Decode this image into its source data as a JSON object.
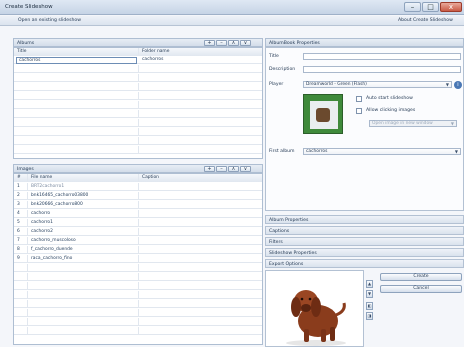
{
  "window": {
    "title": "Create Slideshow",
    "min": "–",
    "max": "□",
    "close": "x"
  },
  "toolbar": {
    "open_link": "Open an existing slideshow",
    "about_link": "About Create Slideshow"
  },
  "albums": {
    "heading": "Albums",
    "columns": [
      "Title",
      "Folder name"
    ],
    "rows": [
      {
        "title": "cachorros",
        "folder": "cachorros"
      }
    ],
    "buttons": {
      "add": "+",
      "remove": "–",
      "up": "∧",
      "down": "∨"
    }
  },
  "images": {
    "heading": "Images",
    "columns": [
      "#",
      "File name",
      "Caption"
    ],
    "rows": [
      {
        "num": "1",
        "file": "BRT2cachorro1",
        "caption": ""
      },
      {
        "num": "2",
        "file": "bnk16465_cachorro03800",
        "caption": ""
      },
      {
        "num": "3",
        "file": "bnk20666_cachorro800",
        "caption": ""
      },
      {
        "num": "4",
        "file": "cachorro",
        "caption": ""
      },
      {
        "num": "5",
        "file": "cachorro1",
        "caption": ""
      },
      {
        "num": "6",
        "file": "cachorro2",
        "caption": ""
      },
      {
        "num": "7",
        "file": "cachorro_muscoloso",
        "caption": ""
      },
      {
        "num": "8",
        "file": "f_cachorro_duende",
        "caption": ""
      },
      {
        "num": "9",
        "file": "raca_cachorro_fino",
        "caption": ""
      }
    ],
    "buttons": {
      "add": "+",
      "remove": "–",
      "up": "∧",
      "down": "∨"
    }
  },
  "properties": {
    "heading": "AlbumBook Properties",
    "title_label": "Title",
    "title_value": "",
    "description_label": "Description",
    "description_value": "",
    "player_label": "Player",
    "player_value": "Dreamworld - Green (Flash)",
    "autostart_label": "Auto start slideshow",
    "clicking_label": "Allow clicking images",
    "disabled_combo": "Open image in new window",
    "first_album_label": "First album",
    "first_album_value": "cachorros"
  },
  "sections": [
    "Album Properties",
    "Captions",
    "Filters",
    "Slideshow Properties",
    "Export Options"
  ],
  "actions": {
    "create": "Create",
    "cancel": "Cancel"
  },
  "colors": {
    "accent": "#4a78b5",
    "panel": "#dbe3ee",
    "header": "#c6d4e6"
  }
}
